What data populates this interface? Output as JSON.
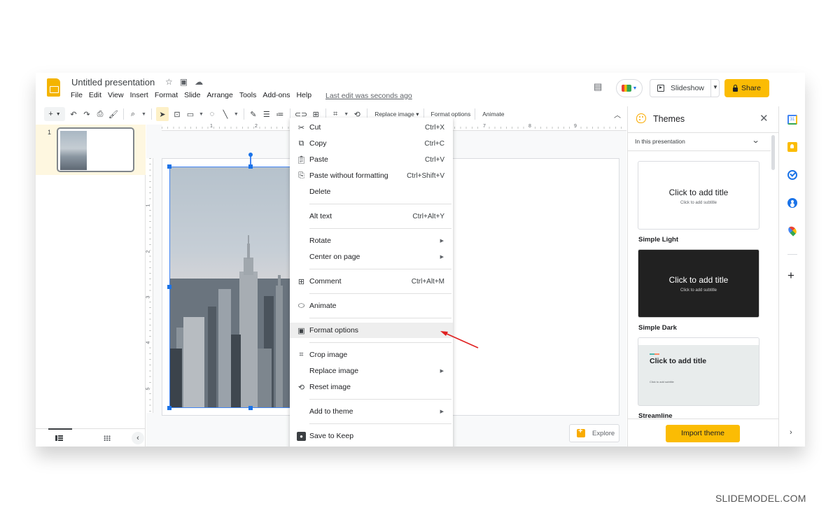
{
  "header": {
    "doc_title": "Untitled presentation",
    "menu": [
      "File",
      "Edit",
      "View",
      "Insert",
      "Format",
      "Slide",
      "Arrange",
      "Tools",
      "Add-ons",
      "Help"
    ],
    "last_edit": "Last edit was seconds ago",
    "slideshow_label": "Slideshow",
    "share_label": "Share",
    "icons": [
      "star-icon",
      "move-to-folder-icon",
      "cloud-saved-icon",
      "comment-history-icon",
      "meet-icon"
    ]
  },
  "toolbar": {
    "replace_image_label": "Replace image",
    "format_options_label": "Format options",
    "animate_label": "Animate"
  },
  "filmstrip": {
    "slides": [
      {
        "number": "1",
        "selected": true
      }
    ]
  },
  "rulers": {
    "horizontal_ticks": [
      "1",
      "2",
      "7",
      "8",
      "9"
    ],
    "vertical_ticks": [
      "1",
      "2",
      "3",
      "4",
      "5"
    ]
  },
  "context_menu": {
    "items": [
      {
        "label": "Cut",
        "shortcut": "Ctrl+X",
        "icon": "scissors-icon"
      },
      {
        "label": "Copy",
        "shortcut": "Ctrl+C",
        "icon": "copy-icon"
      },
      {
        "label": "Paste",
        "shortcut": "Ctrl+V",
        "icon": "paste-icon"
      },
      {
        "label": "Paste without formatting",
        "shortcut": "Ctrl+Shift+V",
        "icon": "paste-plain-icon"
      },
      {
        "label": "Delete",
        "shortcut": ""
      },
      {
        "label": "Alt text",
        "shortcut": "Ctrl+Alt+Y"
      },
      {
        "label": "Rotate",
        "submenu": true
      },
      {
        "label": "Center on page",
        "submenu": true
      },
      {
        "label": "Comment",
        "shortcut": "Ctrl+Alt+M",
        "icon": "add-comment-icon"
      },
      {
        "label": "Animate",
        "icon": "animate-icon"
      },
      {
        "label": "Format options",
        "icon": "format-options-icon",
        "highlighted": true
      },
      {
        "label": "Crop image",
        "icon": "crop-icon"
      },
      {
        "label": "Replace image",
        "submenu": true
      },
      {
        "label": "Reset image",
        "icon": "reset-image-icon"
      },
      {
        "label": "Add to theme",
        "submenu": true
      },
      {
        "label": "Save to Keep",
        "icon": "keep-icon"
      }
    ]
  },
  "explore": {
    "label": "Explore"
  },
  "themes_panel": {
    "title": "Themes",
    "filter": "In this presentation",
    "themes": [
      {
        "name": "Simple Light",
        "title": "Click to add title",
        "subtitle": "Click to add subtitle",
        "bg": "#ffffff",
        "fg": "#202124"
      },
      {
        "name": "Simple Dark",
        "title": "Click to add title",
        "subtitle": "Click to add subtitle",
        "bg": "#212121",
        "fg": "#ffffff"
      },
      {
        "name": "Streamline",
        "title": "Click to add title",
        "subtitle": "Click to add subtitle",
        "bg": "#e8ecec",
        "fg": "#202124"
      }
    ],
    "import_label": "Import theme"
  },
  "addons": [
    "calendar-icon",
    "keep-icon",
    "tasks-icon",
    "contacts-icon",
    "maps-icon"
  ],
  "colors": {
    "accent_yellow": "#fbbc04",
    "selection_blue": "#1a73e8",
    "annotation_red": "#e02020"
  },
  "watermark": "SLIDEMODEL.COM"
}
